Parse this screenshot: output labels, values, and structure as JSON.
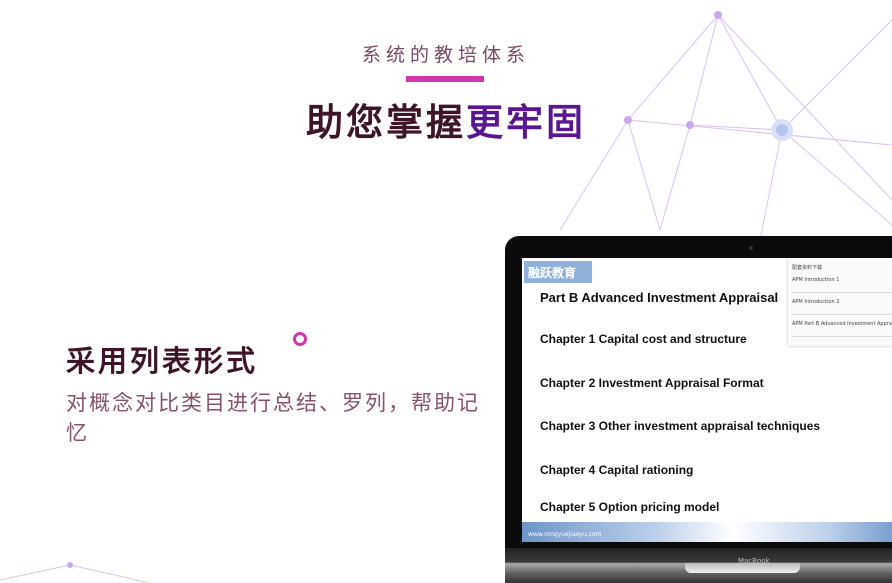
{
  "header": {
    "subtitle": "系统的教培体系",
    "title_main": "助您掌握",
    "title_highlight": "更牢固"
  },
  "feature": {
    "title": "采用列表形式",
    "description": "对概念对比类目进行总结、罗列，帮助记忆"
  },
  "laptop": {
    "brand": "MacBook",
    "logo": "融跃教育",
    "part": "Part  B    Advanced Investment Appraisal",
    "chapters": [
      "Chapter 1 Capital cost and structure",
      "Chapter 2 Investment Appraisal Format",
      "Chapter 3 Other investment appraisal techniques",
      "Chapter 4 Capital rationing",
      "Chapter 5 Option pricing model"
    ],
    "panel": {
      "title": "配套资料下载",
      "items": [
        "APM Introduction 1",
        "APM Introduction 2",
        "APM Part B Advanced Investment Appraisal"
      ]
    },
    "url": "www.rongyuejiaoyu.com"
  },
  "colors": {
    "accent": "#d236ad",
    "title": "#3e1528",
    "highlight": "#5a1590",
    "text": "#86536e"
  }
}
